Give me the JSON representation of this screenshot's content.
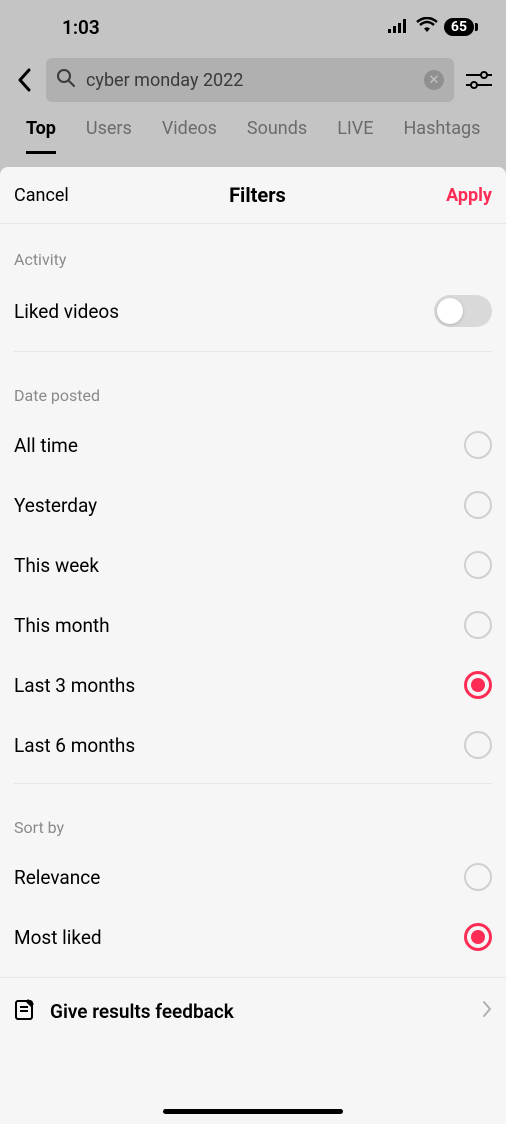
{
  "status": {
    "time": "1:03",
    "battery": "65"
  },
  "search": {
    "query": "cyber monday 2022"
  },
  "tabs": [
    {
      "label": "Top",
      "active": true
    },
    {
      "label": "Users",
      "active": false
    },
    {
      "label": "Videos",
      "active": false
    },
    {
      "label": "Sounds",
      "active": false
    },
    {
      "label": "LIVE",
      "active": false
    },
    {
      "label": "Hashtags",
      "active": false
    }
  ],
  "sheet": {
    "cancel": "Cancel",
    "title": "Filters",
    "apply": "Apply"
  },
  "sections": {
    "activity": {
      "label": "Activity",
      "liked_videos": "Liked videos",
      "liked_videos_on": false
    },
    "date_posted": {
      "label": "Date posted",
      "options": [
        {
          "label": "All time",
          "selected": false
        },
        {
          "label": "Yesterday",
          "selected": false
        },
        {
          "label": "This week",
          "selected": false
        },
        {
          "label": "This month",
          "selected": false
        },
        {
          "label": "Last 3 months",
          "selected": true
        },
        {
          "label": "Last 6 months",
          "selected": false
        }
      ]
    },
    "sort_by": {
      "label": "Sort by",
      "options": [
        {
          "label": "Relevance",
          "selected": false
        },
        {
          "label": "Most liked",
          "selected": true
        }
      ]
    }
  },
  "feedback": {
    "label": "Give results feedback"
  },
  "colors": {
    "accent": "#fe2c55"
  }
}
